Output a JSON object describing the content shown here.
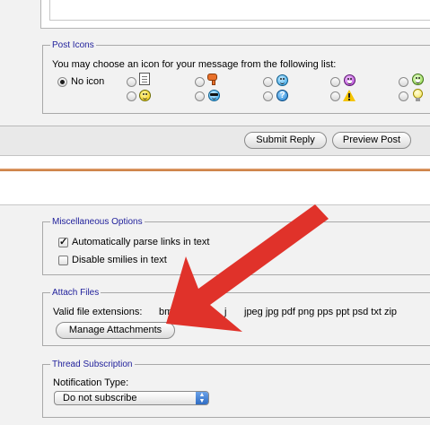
{
  "post_icons": {
    "legend": "Post Icons",
    "instruction": "You may choose an icon for your message from the following list:",
    "no_icon_label": "No icon",
    "icons": [
      "document-icon",
      "thumbs-down-icon",
      "smile-wink-icon",
      "grin-purple-icon",
      "grin-green-icon",
      "smile-icon",
      "cool-sunglasses-icon",
      "question-icon",
      "warning-icon",
      "lightbulb-icon"
    ]
  },
  "actions": {
    "submit_label": "Submit Reply",
    "preview_label": "Preview Post"
  },
  "misc_options": {
    "legend": "Miscellaneous Options",
    "parse_links_label": "Automatically parse links in text",
    "parse_links_checked": true,
    "disable_smilies_label": "Disable smilies in text",
    "disable_smilies_checked": false
  },
  "attach_files": {
    "legend": "Attach Files",
    "extensions_label": "Valid file extensions:",
    "extensions_visible_start": "bm",
    "extensions_visible_mid": "g",
    "extensions_visible_mid2": "j",
    "extensions_rest": "jpeg jpg pdf png pps ppt psd txt zip",
    "manage_label": "Manage Attachments"
  },
  "thread_subscription": {
    "legend": "Thread Subscription",
    "notification_label": "Notification Type:",
    "selected_option": "Do not subscribe"
  },
  "colors": {
    "legend_text": "#22229c",
    "separator": "#c87a3c",
    "arrow": "#e0322a"
  }
}
